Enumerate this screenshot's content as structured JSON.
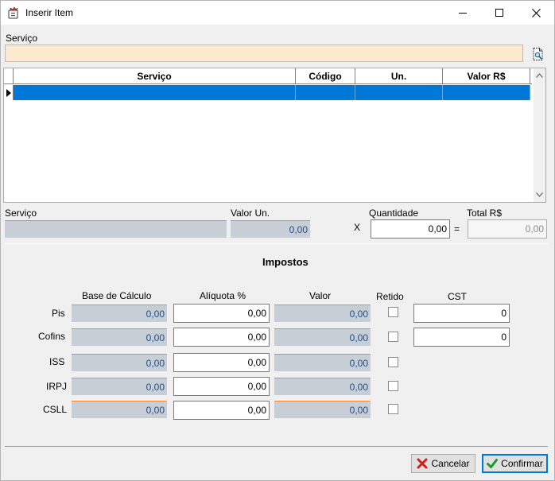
{
  "window": {
    "title": "Inserir Item"
  },
  "search": {
    "label": "Serviço",
    "value": "",
    "placeholder": ""
  },
  "grid": {
    "columns": [
      "Serviço",
      "Código",
      "Un.",
      "Valor R$"
    ],
    "rows": [
      {
        "servico": "",
        "codigo": "",
        "un": "",
        "valor": ""
      }
    ]
  },
  "item": {
    "servico_label": "Serviço",
    "valor_un_label": "Valor Un.",
    "valor_un_value": "0,00",
    "x_label": "X",
    "quantidade_label": "Quantidade",
    "quantidade_value": "0,00",
    "equals_label": "=",
    "total_label": "Total R$",
    "total_value": "0,00"
  },
  "impostos": {
    "title": "Impostos",
    "headers": {
      "base": "Base de Cálculo",
      "aliquota": "Alíquota %",
      "valor": "Valor",
      "retido": "Retido",
      "cst": "CST"
    },
    "rows": [
      {
        "name": "Pis",
        "base": "0,00",
        "aliquota": "0,00",
        "valor": "0,00",
        "retido": false,
        "cst": "0"
      },
      {
        "name": "Cofins",
        "base": "0,00",
        "aliquota": "0,00",
        "valor": "0,00",
        "retido": false,
        "cst": "0"
      },
      {
        "name": "ISS",
        "base": "0,00",
        "aliquota": "0,00",
        "valor": "0,00",
        "retido": false
      },
      {
        "name": "IRPJ",
        "base": "0,00",
        "aliquota": "0,00",
        "valor": "0,00",
        "retido": false
      },
      {
        "name": "CSLL",
        "base": "0,00",
        "aliquota": "0,00",
        "valor": "0,00",
        "retido": false
      }
    ]
  },
  "buttons": {
    "cancel_label": "Cancelar",
    "confirm_label": "Confirmar"
  },
  "colors": {
    "selection": "#0078d7",
    "readonly_bg": "#c8ced6",
    "accent_line": "#f28b30",
    "search_bg": "#fde9d0"
  }
}
